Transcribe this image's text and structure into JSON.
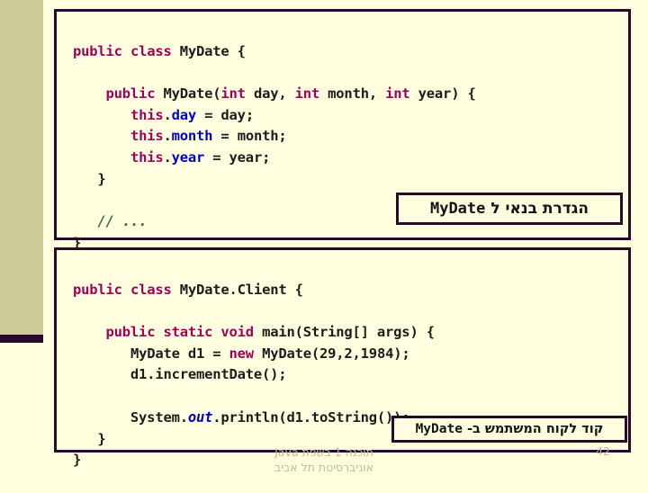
{
  "theme": {
    "background": "#FFFFE0",
    "band_color": "#CCCC96",
    "border_color": "#2A0A2A",
    "keyword_color": "#A0005A",
    "field_color": "#0000CC",
    "comment_color": "#3D6B3D",
    "footer_color": "#BDBD9A"
  },
  "code_top": {
    "lines": [
      {
        "id": "l1",
        "text": "public class MyDate {"
      },
      {
        "id": "l2",
        "text": ""
      },
      {
        "id": "l3",
        "text": "    public MyDate(int day, int month, int year) {"
      },
      {
        "id": "l4",
        "text": "        this.day = day;"
      },
      {
        "id": "l5",
        "text": "        this.month = month;"
      },
      {
        "id": "l6",
        "text": "        this.year = year;"
      },
      {
        "id": "l7",
        "text": "    }"
      },
      {
        "id": "l8",
        "text": ""
      },
      {
        "id": "l9",
        "text": "    // ..."
      },
      {
        "id": "l10",
        "text": "}"
      }
    ],
    "tokens": {
      "kw_public": "public",
      "kw_class": "class",
      "kw_int": "int",
      "kw_this": "this",
      "type_mydate": "MyDate",
      "field_day": "day",
      "field_month": "month",
      "field_year": "year",
      "comment": "// ..."
    }
  },
  "code_bottom": {
    "lines": [
      {
        "id": "b1",
        "text": "public class MyDate.Client {"
      },
      {
        "id": "b2",
        "text": ""
      },
      {
        "id": "b3",
        "text": "    public static void main(String[] args) {"
      },
      {
        "id": "b4",
        "text": "        MyDate d1 = new MyDate(29,2,1984);"
      },
      {
        "id": "b5",
        "text": "        d1.incrementDate();"
      },
      {
        "id": "b6",
        "text": ""
      },
      {
        "id": "b7",
        "text": "        System.out.println(d1.toString());"
      },
      {
        "id": "b8",
        "text": "    }"
      },
      {
        "id": "b9",
        "text": "}"
      }
    ],
    "tokens": {
      "kw_public": "public",
      "kw_class": "class",
      "kw_static": "static",
      "kw_void": "void",
      "kw_new": "new",
      "sout": "out",
      "class_name": "MyDate.Client",
      "args": "29,2,1984"
    }
  },
  "callouts": {
    "constructor": {
      "hebrew": "הגדרת בנאי ל",
      "code": "MyDate"
    },
    "client": {
      "hebrew": "קוד לקוח המשתמש ב-",
      "code": "MyDate"
    }
  },
  "footer": {
    "line1_hebrew": "תוכנה 1 בשפת",
    "line1_latin": "Java",
    "line2": "אוניברסיטת תל אביב",
    "page_number": "42"
  }
}
